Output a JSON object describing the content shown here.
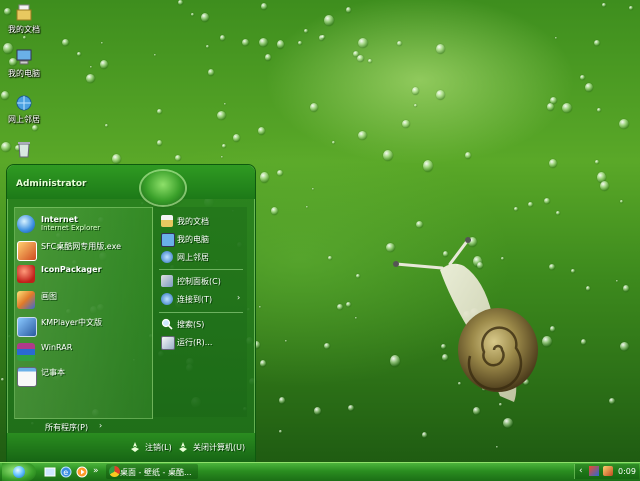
{
  "desktop_icons": [
    {
      "label": "我的文档",
      "icon": "folder-documents-icon"
    },
    {
      "label": "我的电脑",
      "icon": "my-computer-icon"
    },
    {
      "label": "网上邻居",
      "icon": "network-places-icon"
    },
    {
      "label": "",
      "icon": "recycle-bin-icon"
    }
  ],
  "start_menu": {
    "username": "Administrator",
    "programs": [
      {
        "label": "Internet",
        "sublabel": "Internet Explorer",
        "icon": "internet-explorer-icon"
      },
      {
        "label": "SFC桌酷网专用版.exe",
        "icon": "sfc-app-icon"
      },
      {
        "label": "IconPackager",
        "icon": "iconpackager-icon"
      },
      {
        "label": "画图",
        "icon": "paint-icon"
      },
      {
        "label": "KMPlayer中文版",
        "icon": "kmplayer-icon"
      },
      {
        "label": "WinRAR",
        "icon": "winrar-icon"
      },
      {
        "label": "记事本",
        "icon": "notepad-icon"
      }
    ],
    "places": [
      {
        "label": "我的文档",
        "icon": "my-documents-icon"
      },
      {
        "label": "我的电脑",
        "icon": "my-computer-icon"
      },
      {
        "label": "网上邻居",
        "icon": "network-places-icon"
      },
      {
        "label": "控制面板(C)",
        "icon": "control-panel-icon"
      },
      {
        "label": "连接到(T)",
        "icon": "connect-to-icon",
        "submenu": "›"
      },
      {
        "label": "搜索(S)",
        "icon": "search-icon"
      },
      {
        "label": "运行(R)...",
        "icon": "run-icon"
      }
    ],
    "all_programs": "所有程序(P)",
    "all_programs_arrow": "›",
    "logoff": "注销(L)",
    "shutdown": "关闭计算机(U)"
  },
  "taskbar": {
    "quick_launch": [
      "show-desktop-icon",
      "internet-explorer-icon",
      "media-icon"
    ],
    "separator": "»",
    "task_label": "桌面 - 壁纸 - 桌酷...",
    "clock": "0:09"
  },
  "colors": {
    "accent": "#2a8d20",
    "wallpaper": "#4a9a22"
  }
}
